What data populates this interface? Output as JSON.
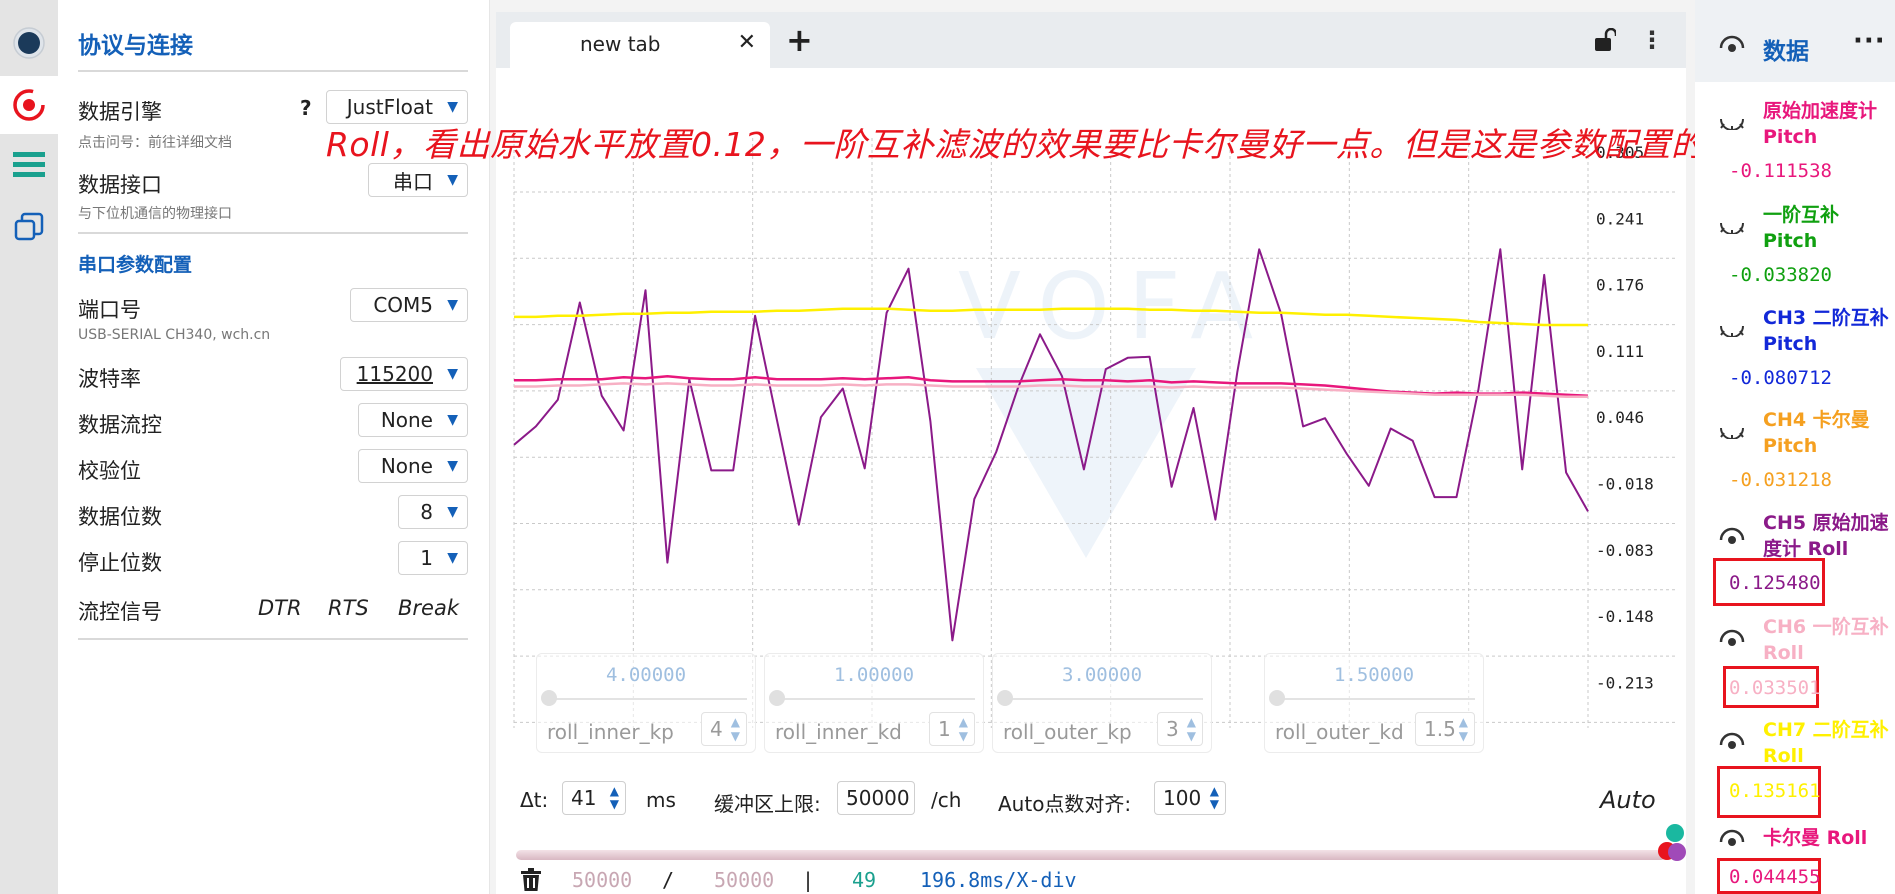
{
  "app": {
    "colors": {
      "accent": "#1460b8",
      "annotation": "#e8141e"
    }
  },
  "rail": {
    "items": [
      {
        "icon": "record-icon"
      },
      {
        "icon": "target-icon"
      },
      {
        "icon": "menu-bars-icon"
      },
      {
        "icon": "windows-stack-icon"
      }
    ]
  },
  "protocol": {
    "title": "协议与连接",
    "engine_label": "数据引擎",
    "engine_help": "?",
    "engine_value": "JustFloat",
    "engine_hint": "点击问号：前往详细文档",
    "interface_label": "数据接口",
    "interface_value": "串口",
    "interface_hint": "与下位机通信的物理接口",
    "serial_title": "串口参数配置",
    "port_label": "端口号",
    "port_value": "COM5",
    "port_hint": "USB-SERIAL CH340, wch.cn",
    "baud_label": "波特率",
    "baud_value": "115200",
    "flow_label": "数据流控",
    "flow_value": "None",
    "parity_label": "校验位",
    "parity_value": "None",
    "databits_label": "数据位数",
    "databits_value": "8",
    "stopbits_label": "停止位数",
    "stopbits_value": "1",
    "signal_label": "流控信号",
    "signal_dtr": "DTR",
    "signal_rts": "RTS",
    "signal_break": "Break"
  },
  "tabs": {
    "active_label": "new tab",
    "close_glyph": "✕",
    "add_glyph": "+",
    "menu_glyph": "⋮"
  },
  "annotation": "Roll，看出原始水平放置0.12，一阶互补滤波的效果要比卡尔曼好一点。但是这是参数配置的原因",
  "chart_data": {
    "type": "line",
    "ylim": [
      -0.213,
      0.305
    ],
    "y_ticks": [
      "0.305",
      "0.241",
      "0.176",
      "0.111",
      "0.046",
      "-0.018",
      "-0.083",
      "-0.148",
      "-0.213"
    ],
    "x_points": 48,
    "series": [
      {
        "name": "CH5 原始加速度计 Roll",
        "color": "#8b1a89",
        "values": [
          0.019,
          0.037,
          0.063,
          0.158,
          0.067,
          0.033,
          0.17,
          -0.096,
          0.083,
          -0.006,
          -0.006,
          0.145,
          0.043,
          -0.059,
          0.046,
          0.074,
          -0.004,
          0.148,
          0.191,
          0.042,
          -0.172,
          -0.034,
          0.012,
          0.075,
          0.127,
          0.086,
          -0.005,
          0.093,
          0.104,
          0.105,
          -0.022,
          0.055,
          -0.054,
          0.09,
          0.21,
          0.147,
          0.037,
          0.045,
          0.01,
          -0.021,
          0.035,
          0.023,
          -0.032,
          -0.032,
          0.073,
          0.21,
          -0.005,
          0.185,
          -0.008,
          -0.046
        ]
      },
      {
        "name": "CH7 二阶互补 Roll",
        "color": "#fff000",
        "values": [
          0.144,
          0.144,
          0.145,
          0.145,
          0.146,
          0.147,
          0.147,
          0.148,
          0.148,
          0.149,
          0.149,
          0.149,
          0.15,
          0.15,
          0.151,
          0.152,
          0.152,
          0.152,
          0.151,
          0.15,
          0.15,
          0.151,
          0.151,
          0.151,
          0.151,
          0.152,
          0.152,
          0.152,
          0.152,
          0.151,
          0.151,
          0.15,
          0.15,
          0.149,
          0.148,
          0.148,
          0.147,
          0.146,
          0.146,
          0.145,
          0.144,
          0.143,
          0.142,
          0.141,
          0.139,
          0.138,
          0.137,
          0.136,
          0.136,
          0.136
        ]
      },
      {
        "name": "卡尔曼 Roll",
        "color": "#e8177c",
        "values": [
          0.082,
          0.082,
          0.083,
          0.083,
          0.083,
          0.085,
          0.084,
          0.086,
          0.084,
          0.083,
          0.083,
          0.085,
          0.083,
          0.083,
          0.083,
          0.084,
          0.083,
          0.084,
          0.085,
          0.082,
          0.081,
          0.081,
          0.081,
          0.081,
          0.082,
          0.083,
          0.082,
          0.082,
          0.081,
          0.082,
          0.08,
          0.081,
          0.08,
          0.079,
          0.079,
          0.079,
          0.078,
          0.077,
          0.075,
          0.073,
          0.071,
          0.07,
          0.069,
          0.07,
          0.069,
          0.069,
          0.07,
          0.069,
          0.068,
          0.067
        ]
      },
      {
        "name": "CH6 一阶互补 Roll",
        "color": "#f7b0c4",
        "values": [
          0.076,
          0.076,
          0.077,
          0.077,
          0.078,
          0.079,
          0.078,
          0.079,
          0.078,
          0.077,
          0.077,
          0.078,
          0.077,
          0.077,
          0.077,
          0.078,
          0.077,
          0.078,
          0.078,
          0.077,
          0.076,
          0.076,
          0.076,
          0.076,
          0.077,
          0.077,
          0.076,
          0.076,
          0.076,
          0.076,
          0.075,
          0.076,
          0.075,
          0.075,
          0.075,
          0.075,
          0.074,
          0.073,
          0.072,
          0.071,
          0.07,
          0.069,
          0.068,
          0.068,
          0.068,
          0.068,
          0.068,
          0.067,
          0.066,
          0.066
        ]
      }
    ]
  },
  "params": [
    {
      "value": "4.00000",
      "name": "roll_inner_kp",
      "spin": "4"
    },
    {
      "value": "1.00000",
      "name": "roll_inner_kd",
      "spin": "1"
    },
    {
      "value": "3.00000",
      "name": "roll_outer_kp",
      "spin": "3"
    },
    {
      "value": "1.50000",
      "name": "roll_outer_kd",
      "spin": "1.5"
    }
  ],
  "controls": {
    "dt_label": "Δt:",
    "dt_value": "41",
    "dt_unit": "ms",
    "buffer_label": "缓冲区上限:",
    "buffer_value": "50000",
    "buffer_unit": "/ch",
    "autopts_label": "Auto点数对齐:",
    "autopts_value": "100",
    "auto_label": "Auto"
  },
  "stats": {
    "count_a": "50000",
    "sep1": "/",
    "count_b": "50000",
    "sep2": "|",
    "fps": "49",
    "xdiv": "196.8ms/X-div"
  },
  "data_panel": {
    "title": "数据",
    "more": "···",
    "channels": [
      {
        "name": "原始加速度计 Pitch",
        "value": "-0.111538",
        "color": "#e8177c",
        "visible": false
      },
      {
        "name": "一阶互补 Pitch",
        "value": "-0.033820",
        "color": "#10a010",
        "visible": false
      },
      {
        "name": "CH3 二阶互补 Pitch",
        "value": "-0.080712",
        "color": "#1228d8",
        "visible": false
      },
      {
        "name": "CH4 卡尔曼 Pitch",
        "value": "-0.031218",
        "color": "#f5a020",
        "visible": false
      },
      {
        "name": "CH5 原始加速度计 Roll",
        "value": "0.125480",
        "color": "#8b1a89",
        "visible": true
      },
      {
        "name": "CH6 一阶互补 Roll",
        "value": "0.033501",
        "color": "#f7b0c4",
        "visible": true
      },
      {
        "name": "CH7 二阶互补 Roll",
        "value": "0.135161",
        "color": "#fff000",
        "visible": true
      },
      {
        "name": "卡尔曼 Roll",
        "value": "0.044455",
        "color": "#e8177c",
        "visible": true
      }
    ]
  }
}
